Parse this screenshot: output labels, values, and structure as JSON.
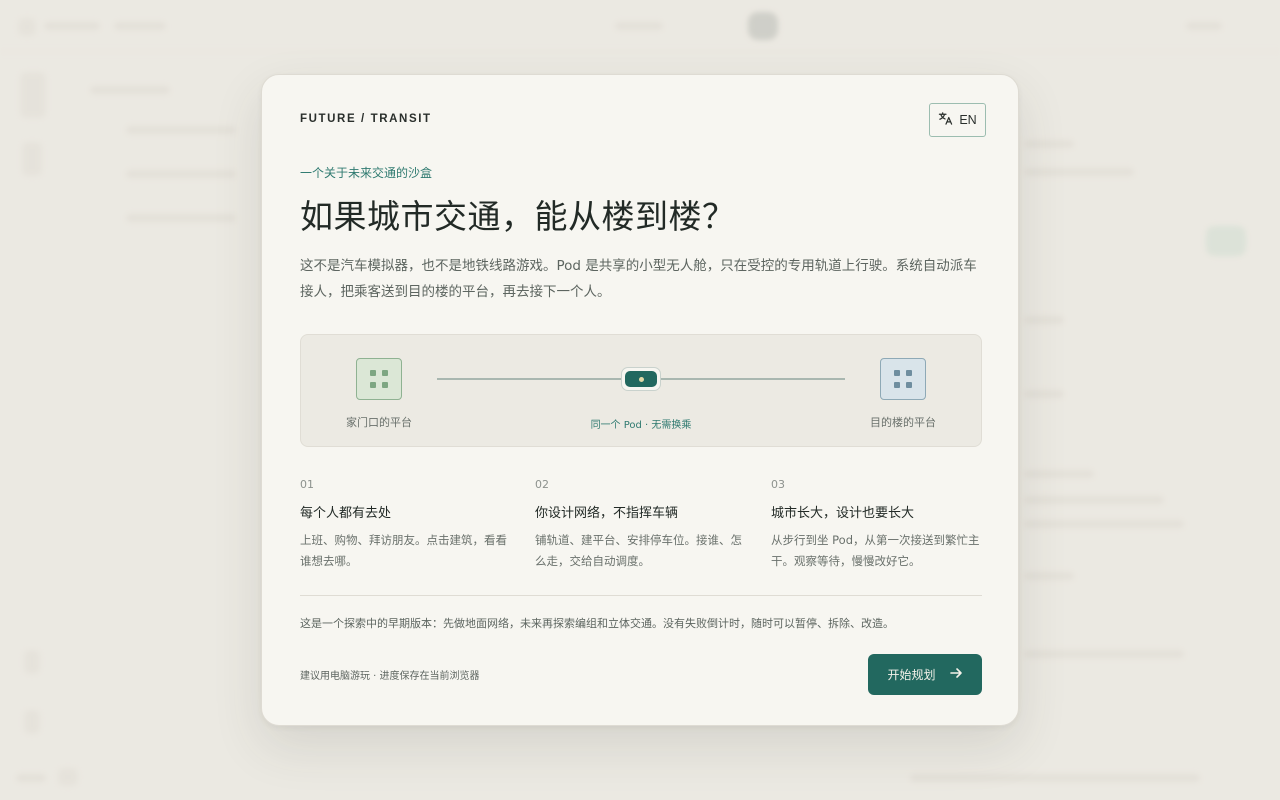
{
  "brand": "FUTURE / TRANSIT",
  "language_button": {
    "icon": "translate-icon",
    "label": "EN"
  },
  "eyebrow": "一个关于未来交通的沙盒",
  "headline": "如果城市交通，能从楼到楼？",
  "lead": "这不是汽车模拟器，也不是地铁线路游戏。Pod 是共享的小型无人舱，只在受控的专用轨道上行驶。系统自动派车接人，把乘客送到目的楼的平台，再去接下一个人。",
  "journey": {
    "origin_label": "家门口的平台",
    "destination_label": "目的楼的平台",
    "pod_caption": "同一个 Pod · 无需换乘"
  },
  "features": [
    {
      "num": "01",
      "title": "每个人都有去处",
      "body": "上班、购物、拜访朋友。点击建筑，看看谁想去哪。"
    },
    {
      "num": "02",
      "title": "你设计网络，不指挥车辆",
      "body": "铺轨道、建平台、安排停车位。接谁、怎么走，交给自动调度。"
    },
    {
      "num": "03",
      "title": "城市长大，设计也要长大",
      "body": "从步行到坐 Pod，从第一次接送到繁忙主干。观察等待，慢慢改好它。"
    }
  ],
  "note": "这是一个探索中的早期版本：先做地面网络，未来再探索编组和立体交通。没有失败倒计时，随时可以暂停、拆除、改造。",
  "hint": "建议用电脑游玩 · 进度保存在当前浏览器",
  "start_button": {
    "label": "开始规划",
    "icon": "arrow-right-icon"
  },
  "colors": {
    "accent": "#22685f",
    "accent_text": "#2f7a70",
    "modal_bg": "#f7f6f1",
    "page_bg": "#ece9e2"
  }
}
